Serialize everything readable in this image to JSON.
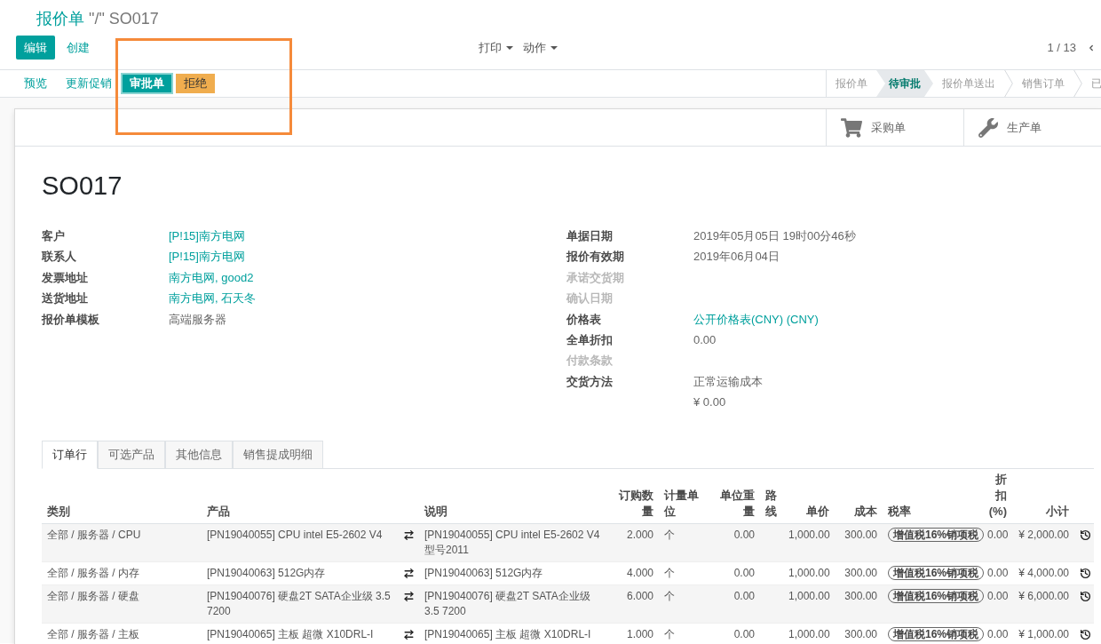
{
  "breadcrumb": {
    "parent": "报价单",
    "current": "\"/\" SO017"
  },
  "control_panel": {
    "buttons": [
      {
        "label": "编辑",
        "kind": "primary"
      },
      {
        "label": "创建",
        "kind": "link"
      }
    ],
    "menus": [
      "打印",
      "动作"
    ],
    "pager": "1 / 13"
  },
  "header": {
    "buttons": [
      {
        "label": "预览",
        "kind": "link"
      },
      {
        "label": "更新促销",
        "kind": "link"
      },
      {
        "label": "审批单",
        "kind": "primary"
      },
      {
        "label": "拒绝",
        "kind": "warning"
      }
    ],
    "statusbar": [
      {
        "label": "报价单",
        "selected": false
      },
      {
        "label": "待审批",
        "selected": true
      },
      {
        "label": "报价单送出",
        "selected": false
      },
      {
        "label": "销售订单",
        "selected": false
      },
      {
        "label": "已",
        "selected": false
      }
    ]
  },
  "highlight": {
    "kind": "rectangle"
  },
  "smart_buttons": [
    {
      "label": "采购单",
      "kind": "purchase"
    },
    {
      "label": "生产单",
      "kind": "manufacturing"
    }
  ],
  "title": "SO017",
  "fields_left": [
    {
      "label": "客户",
      "value": "[P!15]南方电网",
      "kind": "link",
      "empty": false
    },
    {
      "label": "联系人",
      "value": "[P!15]南方电网",
      "kind": "link",
      "empty": false
    },
    {
      "label": "发票地址",
      "value": "南方电网, good2",
      "kind": "link",
      "empty": false
    },
    {
      "label": "送货地址",
      "value": "南方电网, 石天冬",
      "kind": "link",
      "empty": false
    },
    {
      "label": "报价单模板",
      "value": "高端服务器",
      "kind": "text",
      "empty": false
    }
  ],
  "fields_right": [
    {
      "label": "单据日期",
      "value": "2019年05月05日 19时00分46秒",
      "kind": "text",
      "empty": false
    },
    {
      "label": "报价有效期",
      "value": "2019年06月04日",
      "kind": "text",
      "empty": false
    },
    {
      "label": "承诺交货期",
      "empty": true
    },
    {
      "label": "确认日期",
      "empty": true
    },
    {
      "label": "价格表",
      "value": "公开价格表(CNY) (CNY)",
      "kind": "link",
      "empty": false
    },
    {
      "label": "全单折扣",
      "value": "0.00",
      "kind": "text",
      "empty": false
    },
    {
      "label": "付款条款",
      "empty": true
    },
    {
      "label": "交货方法",
      "value": "正常运输成本",
      "note": "¥ 0.00",
      "kind": "text",
      "empty": false
    }
  ],
  "tabs": [
    {
      "label": "订单行",
      "selected": true
    },
    {
      "label": "可选产品",
      "selected": false
    },
    {
      "label": "其他信息",
      "selected": false
    },
    {
      "label": "销售提成明细",
      "selected": false
    }
  ],
  "order_lines": {
    "columns": [
      "类别",
      "产品",
      "说明",
      "订购数量",
      "计量单位",
      "单位重量",
      "路线",
      "单价",
      "成本",
      "税率",
      "折扣(%)",
      "小计"
    ],
    "rows": [
      {
        "category": "全部 / 服务器 / CPU",
        "product": "[PN19040055] CPU intel E5-2602 V4",
        "description": "[PN19040055] CPU intel E5-2602 V4 型号2011",
        "quantity": "2.000",
        "uom": "个",
        "weight": "0.00",
        "unit_price": "1,000.00",
        "cost": "300.00",
        "tax": "增值税16%销项税",
        "discount": "0.00",
        "subtotal": "¥ 2,000.00"
      },
      {
        "category": "全部 / 服务器 / 内存",
        "product": "[PN19040063] 512G内存",
        "description": "[PN19040063] 512G内存",
        "quantity": "4.000",
        "uom": "个",
        "weight": "0.00",
        "unit_price": "1,000.00",
        "cost": "300.00",
        "tax": "增值税16%销项税",
        "discount": "0.00",
        "subtotal": "¥ 4,000.00"
      },
      {
        "category": "全部 / 服务器 / 硬盘",
        "product": "[PN19040076] 硬盘2T SATA企业级 3.5 7200",
        "description": "[PN19040076] 硬盘2T SATA企业级 3.5 7200",
        "quantity": "6.000",
        "uom": "个",
        "weight": "0.00",
        "unit_price": "1,000.00",
        "cost": "300.00",
        "tax": "增值税16%销项税",
        "discount": "0.00",
        "subtotal": "¥ 6,000.00"
      },
      {
        "category": "全部 / 服务器 / 主板",
        "product": "[PN19040065] 主板 超微 X10DRL-I",
        "description": "[PN19040065] 主板 超微 X10DRL-I",
        "quantity": "1.000",
        "uom": "个",
        "weight": "0.00",
        "unit_price": "1,000.00",
        "cost": "300.00",
        "tax": "增值税16%销项税",
        "discount": "0.00",
        "subtotal": "¥ 1,000.00"
      }
    ]
  }
}
